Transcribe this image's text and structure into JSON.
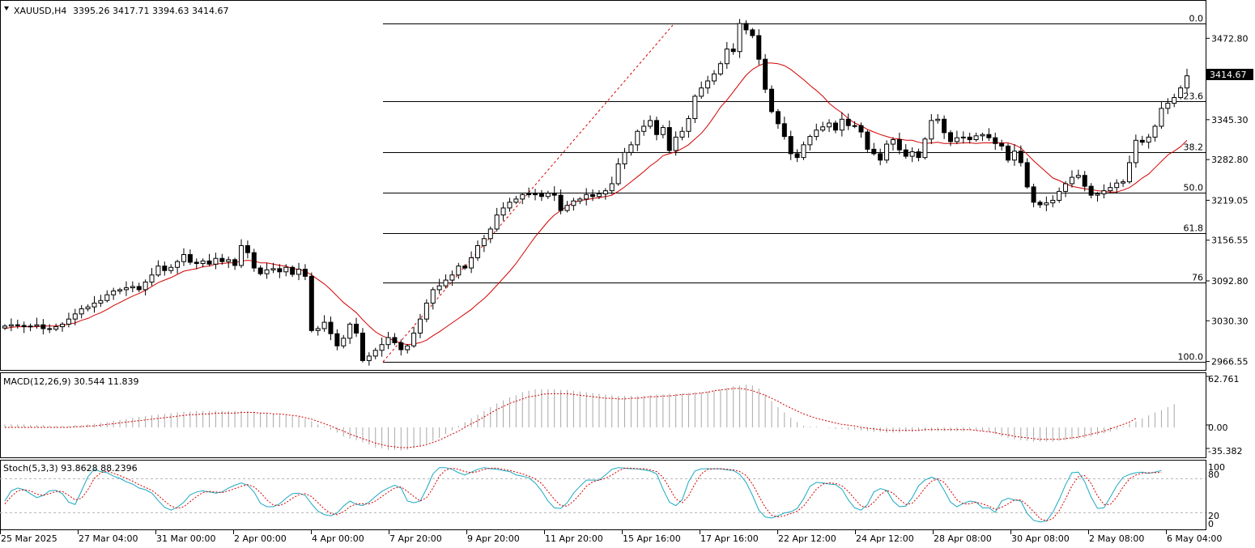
{
  "main": {
    "symbol_label": "XAUUSD,H4",
    "ohlc_label": "3395.26 3417.71 3394.63 3414.67",
    "current_price_label": "3414.67"
  },
  "macd_panel": {
    "label": "MACD(12,26,9) 30.544 11.839"
  },
  "stoch_panel": {
    "label": "Stoch(5,3,3) 93.8628 88.2396"
  },
  "colors": {
    "candle_outline": "#000000",
    "bull_fill": "#ffffff",
    "bear_fill": "#000000",
    "ma_line": "#d40000",
    "fib_line": "#000000",
    "fib_trend": "#d40000",
    "macd_hist": "#a8a8a8",
    "macd_signal": "#d40000",
    "stoch_main": "#1ba9c2",
    "stoch_signal": "#d40000",
    "grid_dash": "#b8b8b8"
  },
  "chart_data": [
    {
      "type": "candlestick",
      "symbol": "XAUUSD",
      "timeframe": "H4",
      "y_ticks": [
        "3472.80",
        "3345.30",
        "3282.80",
        "3219.05",
        "3156.55",
        "3092.80",
        "3030.30",
        "2966.55"
      ],
      "ylim": [
        2950,
        3500
      ],
      "x_ticks": [
        "25 Mar 2025",
        "27 Mar 04:00",
        "31 Mar 00:00",
        "2 Apr 00:00",
        "4 Apr 00:00",
        "7 Apr 20:00",
        "9 Apr 20:00",
        "11 Apr 20:00",
        "15 Apr 16:00",
        "17 Apr 16:00",
        "22 Apr 12:00",
        "24 Apr 12:00",
        "28 Apr 08:00",
        "30 Apr 08:00",
        "2 May 08:00",
        "6 May 04:00"
      ],
      "closes": [
        3022,
        3024,
        3023,
        3021,
        3022,
        3024,
        3018,
        3017,
        3021,
        3025,
        3033,
        3041,
        3049,
        3052,
        3058,
        3062,
        3071,
        3077,
        3079,
        3082,
        3084,
        3079,
        3091,
        3102,
        3116,
        3109,
        3114,
        3123,
        3134,
        3122,
        3120,
        3124,
        3119,
        3128,
        3123,
        3126,
        3117,
        3148,
        3137,
        3113,
        3104,
        3110,
        3112,
        3107,
        3114,
        3103,
        3111,
        3100,
        3015,
        3018,
        3028,
        3010,
        2991,
        3003,
        3025,
        3011,
        2968,
        2975,
        2984,
        2993,
        3004,
        2996,
        2985,
        2991,
        3011,
        3033,
        3058,
        3079,
        3085,
        3094,
        3102,
        3116,
        3113,
        3129,
        3148,
        3159,
        3174,
        3196,
        3207,
        3216,
        3221,
        3228,
        3229,
        3229,
        3225,
        3230,
        3227,
        3203,
        3211,
        3218,
        3221,
        3228,
        3225,
        3229,
        3234,
        3245,
        3276,
        3294,
        3306,
        3327,
        3335,
        3344,
        3322,
        3333,
        3297,
        3318,
        3327,
        3347,
        3382,
        3395,
        3406,
        3417,
        3433,
        3456,
        3452,
        3496,
        3486,
        3477,
        3440,
        3393,
        3358,
        3339,
        3319,
        3292,
        3286,
        3306,
        3319,
        3329,
        3334,
        3340,
        3329,
        3346,
        3336,
        3336,
        3326,
        3299,
        3292,
        3282,
        3307,
        3314,
        3298,
        3288,
        3295,
        3286,
        3315,
        3344,
        3346,
        3325,
        3311,
        3317,
        3318,
        3314,
        3320,
        3322,
        3317,
        3308,
        3304,
        3282,
        3296,
        3278,
        3240,
        3216,
        3212,
        3215,
        3219,
        3233,
        3245,
        3255,
        3258,
        3241,
        3227,
        3229,
        3234,
        3239,
        3246,
        3248,
        3278,
        3313,
        3310,
        3318,
        3335,
        3363,
        3371,
        3380,
        3395,
        3414
      ],
      "ma_series": [
        3018,
        3020,
        3021,
        3021,
        3021,
        3021,
        3022,
        3022,
        3022,
        3023,
        3025,
        3027,
        3031,
        3034,
        3039,
        3043,
        3048,
        3054,
        3059,
        3064,
        3069,
        3073,
        3078,
        3084,
        3090,
        3094,
        3098,
        3103,
        3108,
        3110,
        3112,
        3115,
        3116,
        3119,
        3120,
        3121,
        3121,
        3124,
        3125,
        3124,
        3121,
        3121,
        3119,
        3117,
        3116,
        3112,
        3111,
        3108,
        3102,
        3095,
        3088,
        3079,
        3069,
        3059,
        3051,
        3043,
        3032,
        3022,
        3013,
        3007,
        3003,
        2999,
        2995,
        2993,
        2994,
        2996,
        3000,
        3007,
        3013,
        3020,
        3027,
        3034,
        3041,
        3048,
        3057,
        3065,
        3075,
        3086,
        3097,
        3108,
        3120,
        3134,
        3148,
        3162,
        3174,
        3186,
        3196,
        3203,
        3210,
        3215,
        3219,
        3220,
        3222,
        3223,
        3225,
        3227,
        3233,
        3240,
        3248,
        3256,
        3264,
        3273,
        3280,
        3289,
        3292,
        3295,
        3300,
        3306,
        3315,
        3324,
        3336,
        3350,
        3365,
        3376,
        3389,
        3402,
        3415,
        3424,
        3430,
        3434,
        3434,
        3433,
        3430,
        3424,
        3416,
        3408,
        3399,
        3391,
        3382,
        3371,
        3363,
        3356,
        3347,
        3340,
        3336,
        3330,
        3326,
        3322,
        3319,
        3316,
        3315,
        3313,
        3313,
        3310,
        3308,
        3309,
        3310,
        3308,
        3308,
        3308,
        3309,
        3309,
        3308,
        3309,
        3309,
        3309,
        3309,
        3309,
        3306,
        3301,
        3291,
        3281,
        3272,
        3263,
        3254,
        3250,
        3245,
        3241,
        3239,
        3237,
        3236,
        3234,
        3233,
        3232,
        3232,
        3235,
        3239,
        3246,
        3254,
        3260,
        3270,
        3280,
        3290,
        3296,
        3303,
        3313
      ]
    },
    {
      "type": "bar",
      "title": "MACD(12,26,9)",
      "main_value": 30.544,
      "signal_value": 11.839,
      "y_ticks": [
        "62.761",
        "0.00",
        "-35.382"
      ],
      "ylim": [
        -35.382,
        62.761
      ],
      "histogram": [
        4,
        4,
        4,
        4,
        3,
        3,
        3,
        2,
        2,
        2,
        2,
        3,
        3,
        4,
        5,
        6,
        7,
        9,
        10,
        11,
        13,
        14,
        15,
        16,
        17,
        18,
        19,
        20,
        21,
        21,
        22,
        22,
        22,
        22,
        22,
        22,
        22,
        22,
        22,
        21,
        20,
        19,
        18,
        17,
        16,
        15,
        14,
        11,
        8,
        4,
        1,
        -3,
        -7,
        -12,
        -15,
        -17,
        -20,
        -23,
        -27,
        -28,
        -30,
        -30,
        -31,
        -30,
        -28,
        -25,
        -22,
        -18,
        -14,
        -9,
        -4,
        2,
        7,
        12,
        17,
        22,
        27,
        32,
        36,
        40,
        43,
        47,
        49,
        51,
        51,
        51,
        51,
        50,
        50,
        49,
        48,
        47,
        46,
        45,
        44,
        43,
        42,
        42,
        42,
        42,
        42,
        43,
        44,
        44,
        45,
        45,
        45,
        46,
        47,
        47,
        48,
        49,
        51,
        53,
        55,
        56,
        57,
        56,
        52,
        44,
        35,
        27,
        20,
        13,
        7,
        2,
        1,
        1,
        0,
        -1,
        -2,
        -2,
        -3,
        -3,
        -4,
        -5,
        -6,
        -6,
        -7,
        -7,
        -7,
        -6,
        -6,
        -5,
        -5,
        -5,
        -5,
        -5,
        -5,
        -5,
        -5,
        -4,
        -4,
        -5,
        -6,
        -9,
        -12,
        -14,
        -16,
        -17,
        -18,
        -19,
        -19,
        -19,
        -19,
        -18,
        -17,
        -16,
        -15,
        -14,
        -12,
        -10,
        -8,
        -6,
        -3,
        1,
        5,
        8,
        12,
        16,
        20,
        23,
        27,
        31
      ],
      "signal": [
        0,
        0,
        0,
        0,
        0,
        0,
        0,
        0,
        0,
        0,
        0,
        1,
        1,
        2,
        2,
        3,
        4,
        5,
        6,
        7,
        8,
        9,
        10,
        11,
        12,
        13,
        14,
        15,
        16,
        17,
        17,
        18,
        18,
        19,
        19,
        19,
        19,
        20,
        20,
        20,
        19,
        19,
        18,
        18,
        17,
        16,
        15,
        13,
        11,
        8,
        5,
        2,
        -2,
        -5,
        -9,
        -12,
        -15,
        -18,
        -21,
        -23,
        -25,
        -26,
        -27,
        -27,
        -26,
        -25,
        -23,
        -20,
        -17,
        -13,
        -9,
        -5,
        0,
        5,
        9,
        14,
        19,
        24,
        28,
        32,
        35,
        38,
        41,
        42,
        44,
        45,
        45,
        45,
        45,
        44,
        43,
        42,
        41,
        40,
        39,
        39,
        38,
        38,
        39,
        39,
        40,
        41,
        41,
        42,
        42,
        43,
        44,
        44,
        45,
        46,
        47,
        49,
        50,
        51,
        52,
        52,
        51,
        49,
        46,
        43,
        39,
        35,
        30,
        26,
        22,
        18,
        15,
        12,
        10,
        8,
        6,
        4,
        3,
        2,
        0,
        -1,
        -2,
        -3,
        -4,
        -4,
        -4,
        -4,
        -4,
        -4,
        -3,
        -3,
        -3,
        -3,
        -3,
        -3,
        -3,
        -3,
        -4,
        -5,
        -6,
        -7,
        -9,
        -10,
        -12,
        -13,
        -14,
        -15,
        -16,
        -16,
        -16,
        -16,
        -15,
        -14,
        -13,
        -11,
        -9,
        -7,
        -5,
        -2,
        1,
        4,
        7,
        12
      ]
    },
    {
      "type": "line",
      "title": "Stoch(5,3,3)",
      "main_value": 93.8628,
      "signal_value": 88.2396,
      "y_ticks": [
        "100",
        "80",
        "20",
        "0"
      ],
      "ylim": [
        0,
        100
      ],
      "levels": [
        80,
        20
      ],
      "series": [
        {
          "name": "Main",
          "values": [
            40,
            58,
            63,
            60,
            53,
            46,
            50,
            58,
            59,
            53,
            38,
            34,
            58,
            83,
            96,
            92,
            90,
            84,
            80,
            74,
            70,
            63,
            60,
            54,
            41,
            29,
            24,
            29,
            38,
            51,
            56,
            58,
            56,
            54,
            56,
            63,
            68,
            72,
            68,
            56,
            36,
            30,
            30,
            35,
            45,
            53,
            54,
            50,
            35,
            22,
            16,
            14,
            19,
            31,
            40,
            34,
            32,
            38,
            48,
            57,
            63,
            68,
            63,
            40,
            37,
            40,
            62,
            88,
            99,
            99,
            96,
            90,
            86,
            91,
            96,
            99,
            97,
            96,
            94,
            92,
            86,
            84,
            81,
            72,
            58,
            40,
            28,
            27,
            37,
            54,
            66,
            77,
            77,
            77,
            86,
            96,
            99,
            98,
            97,
            97,
            95,
            93,
            88,
            61,
            38,
            32,
            42,
            74,
            93,
            97,
            97,
            97,
            97,
            95,
            94,
            87,
            73,
            50,
            24,
            12,
            10,
            14,
            19,
            21,
            27,
            44,
            66,
            73,
            72,
            70,
            69,
            61,
            42,
            28,
            24,
            34,
            56,
            62,
            59,
            40,
            30,
            31,
            46,
            67,
            77,
            82,
            78,
            59,
            38,
            30,
            36,
            40,
            38,
            28,
            28,
            20,
            40,
            45,
            42,
            40,
            18,
            6,
            3,
            5,
            20,
            43,
            69,
            90,
            91,
            74,
            47,
            27,
            28,
            47,
            67,
            82,
            87,
            90,
            91,
            89,
            91,
            94
          ],
          "color": "#1ba9c2"
        },
        {
          "name": "Signal",
          "values": [
            35,
            48,
            58,
            60,
            58,
            52,
            50,
            53,
            57,
            57,
            50,
            42,
            45,
            60,
            80,
            90,
            93,
            89,
            85,
            80,
            75,
            69,
            64,
            59,
            50,
            40,
            31,
            27,
            30,
            39,
            48,
            55,
            57,
            56,
            55,
            58,
            62,
            66,
            69,
            65,
            55,
            42,
            33,
            32,
            37,
            45,
            51,
            53,
            48,
            37,
            26,
            18,
            16,
            21,
            30,
            35,
            35,
            35,
            40,
            48,
            56,
            63,
            65,
            57,
            48,
            40,
            46,
            63,
            84,
            95,
            98,
            96,
            92,
            90,
            92,
            96,
            98,
            98,
            96,
            94,
            91,
            88,
            84,
            79,
            71,
            57,
            43,
            32,
            31,
            40,
            52,
            66,
            74,
            77,
            80,
            86,
            93,
            98,
            98,
            97,
            97,
            95,
            92,
            82,
            63,
            44,
            37,
            49,
            70,
            88,
            96,
            97,
            97,
            96,
            95,
            92,
            85,
            70,
            49,
            29,
            15,
            12,
            14,
            18,
            22,
            31,
            46,
            61,
            70,
            72,
            71,
            67,
            57,
            44,
            31,
            29,
            38,
            51,
            59,
            54,
            43,
            34,
            36,
            48,
            63,
            75,
            79,
            73,
            58,
            42,
            35,
            35,
            38,
            35,
            31,
            25,
            29,
            35,
            42,
            42,
            33,
            21,
            9,
            5,
            9,
            23,
            44,
            67,
            83,
            85,
            71,
            49,
            34,
            34,
            47,
            65,
            79,
            86,
            89,
            90,
            90,
            91
          ]
        }
      ]
    }
  ],
  "fib_levels": [
    {
      "label": "0.0",
      "price": 3496
    },
    {
      "label": "23.6",
      "price": 3374
    },
    {
      "label": "38.2",
      "price": 3295
    },
    {
      "label": "50.0",
      "price": 3231
    },
    {
      "label": "61.8",
      "price": 3167
    },
    {
      "label": "76",
      "price": 3090
    },
    {
      "label": "100.0",
      "price": 2966
    }
  ]
}
